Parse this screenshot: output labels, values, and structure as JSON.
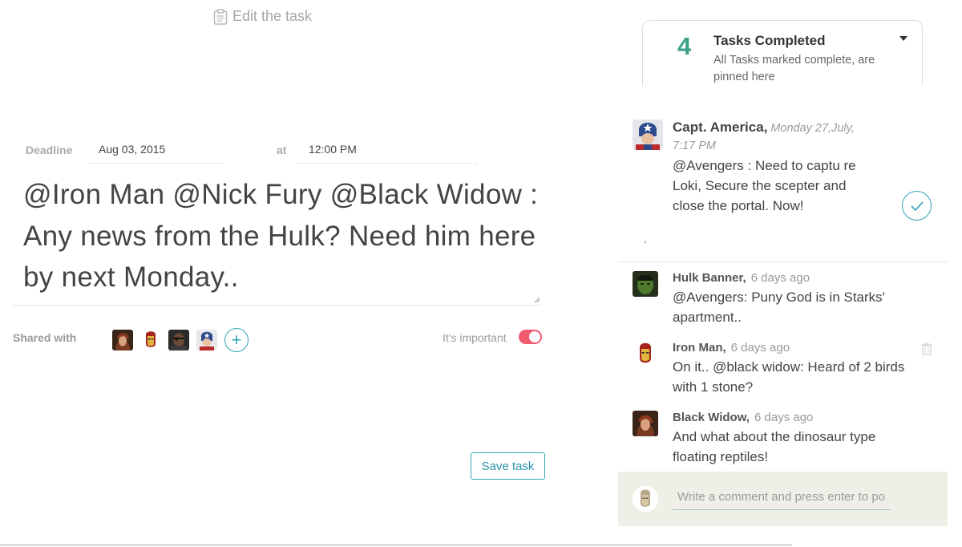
{
  "editor": {
    "header": "Edit the task",
    "deadline_label": "Deadline",
    "date_value": "Aug 03, 2015",
    "at_label": "at",
    "time_value": "12:00 PM",
    "task_text": "@Iron Man @Nick Fury @Black Widow : Any news from the Hulk? Need him here by next Monday..",
    "shared_label": "Shared with",
    "shared_avatars": [
      "black-widow-avatar",
      "iron-man-avatar",
      "nick-fury-avatar",
      "capt-america-avatar"
    ],
    "important_label": "It's important",
    "important_on": true,
    "save_label": "Save task"
  },
  "tasks_completed": {
    "count": "4",
    "title": "Tasks Completed",
    "subtitle": "All Tasks marked complete, are pinned here"
  },
  "pinned": {
    "name": "Capt. America,",
    "time": "Monday 27,July, 7:17 PM",
    "message": "@Avengers : Need to captu re Loki, Secure the scepter and close the portal. Now!",
    "stray_mark": ","
  },
  "comments": [
    {
      "name": "Hulk Banner,",
      "time": "6 days ago",
      "message": "@Avengers: Puny God is in Starks' apartment.."
    },
    {
      "name": "Iron Man,",
      "time": "6 days ago",
      "message": "On it.. @black widow: Heard of 2 birds with 1 stone?"
    },
    {
      "name": "Black Widow,",
      "time": "6 days ago",
      "message": "And what about the dinosaur type floating reptiles!"
    }
  ],
  "composer": {
    "placeholder": "Write a comment and press enter to post"
  },
  "colors": {
    "accent": "#34a3b8",
    "completed_count": "#3aa18a",
    "toggle_on": "#f05a6e",
    "composer_bg": "#f0efe7"
  }
}
